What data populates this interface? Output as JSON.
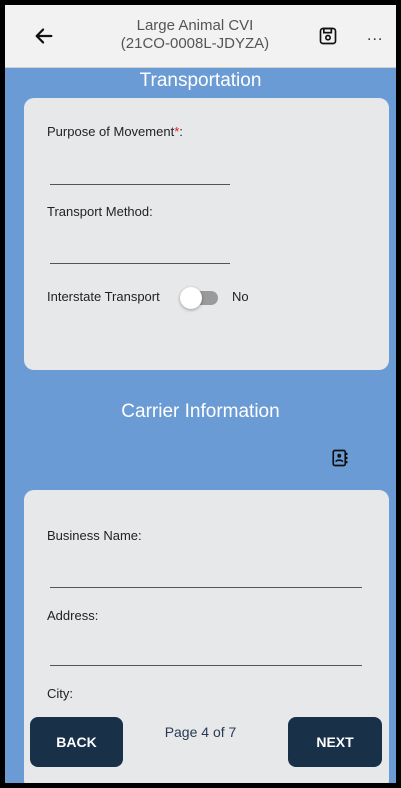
{
  "header": {
    "title": "Large Animal CVI",
    "subtitle": "(21CO-0008L-JDYZA)",
    "more": "..."
  },
  "transportation": {
    "title": "Transportation",
    "purpose_label": "Purpose of Movement",
    "required_mark": "*",
    "purpose_colon": ":",
    "method_label": "Transport Method:",
    "interstate_label": "Interstate Transport",
    "interstate_value": "No"
  },
  "carrier": {
    "title": "Carrier Information",
    "business_label": "Business Name:",
    "address_label": "Address:",
    "city_label": "City:"
  },
  "footer": {
    "back_label": "BACK",
    "page_indicator": "Page 4 of 7",
    "next_label": "NEXT"
  },
  "colors": {
    "background": "#6a9bd4",
    "card": "#e6e8ea",
    "button": "#183048",
    "required": "#e02020"
  },
  "icons": {
    "back": "arrow-left-icon",
    "save": "save-icon",
    "contact": "contact-book-icon"
  }
}
